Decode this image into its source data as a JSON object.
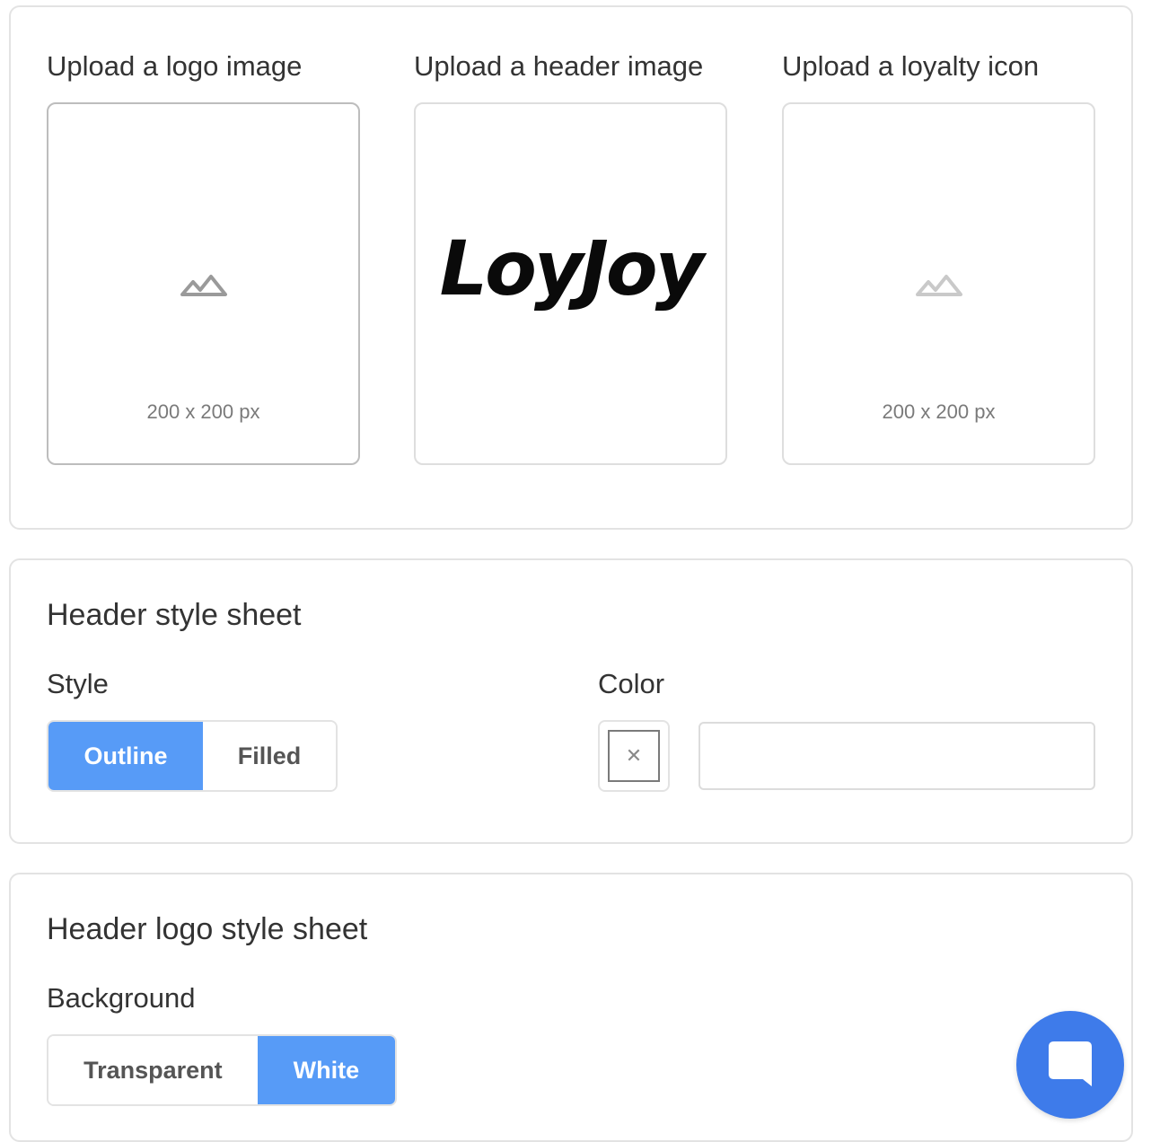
{
  "uploads": [
    {
      "label": "Upload a logo image",
      "hint": "200 x 200 px"
    },
    {
      "label": "Upload a header image",
      "image_text": "LoyJoy"
    },
    {
      "label": "Upload a loyalty icon",
      "hint": "200 x 200 px"
    }
  ],
  "header_style": {
    "title": "Header style sheet",
    "style_label": "Style",
    "style_options": [
      "Outline",
      "Filled"
    ],
    "style_selected": "Outline",
    "color_label": "Color",
    "color_value": ""
  },
  "header_logo_style": {
    "title": "Header logo style sheet",
    "background_label": "Background",
    "background_options": [
      "Transparent",
      "White"
    ],
    "background_selected": "White"
  },
  "colors": {
    "accent": "#579bf7",
    "chat_button": "#3e7bea"
  },
  "icons": {
    "image_placeholder": "image-placeholder-icon",
    "clear": "close-icon",
    "chat": "chat-icon"
  }
}
